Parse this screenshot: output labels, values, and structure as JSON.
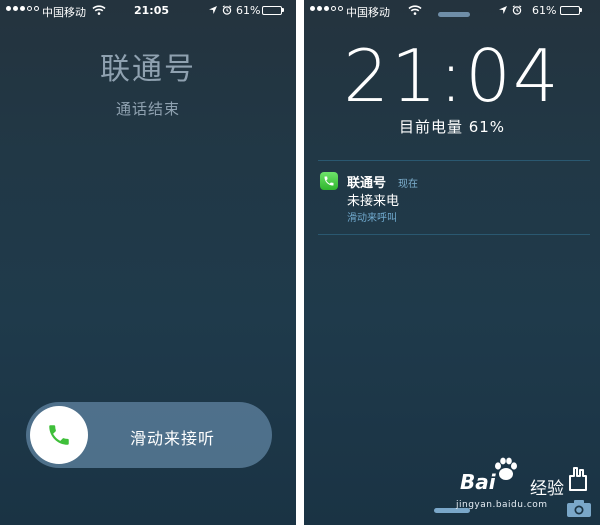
{
  "status_bar": {
    "carrier": "中国移动",
    "time": "21:05",
    "battery_percent": "61%",
    "battery_level": 0.61,
    "signal_bars_filled": 3,
    "signal_bars_total": 5
  },
  "incoming_call": {
    "caller": "联通号",
    "status": "通话结束",
    "slider_label": "滑动来接听"
  },
  "lock_screen": {
    "time": "21:04",
    "battery_text": "目前电量 61%",
    "notification": {
      "app": "联通号",
      "time": "现在",
      "message": "未接来电",
      "action": "滑动来呼叫"
    }
  },
  "watermark": {
    "brand": "Bai",
    "label": "经验",
    "url": "jingyan.baidu.com"
  },
  "colors": {
    "battery_fill": "#5ddc3a",
    "phone_green": "#3fbf3a",
    "slider_bg": "#5f86a6"
  },
  "icons": [
    "wifi-icon",
    "location-arrow-icon",
    "alarm-clock-icon",
    "battery-icon",
    "phone-icon",
    "camera-icon",
    "paw-icon",
    "hand-icon"
  ]
}
